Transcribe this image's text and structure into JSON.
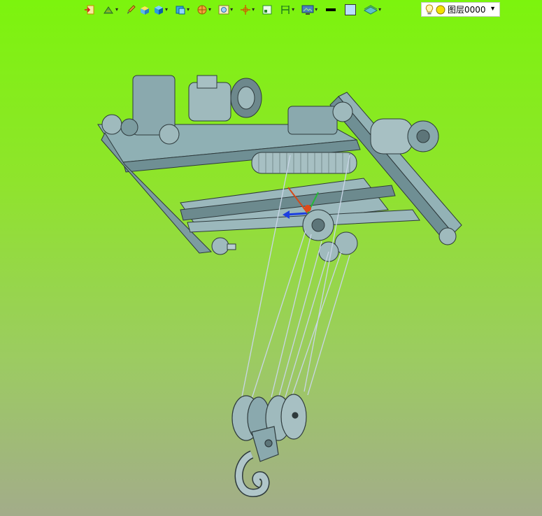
{
  "toolbar": {
    "items": [
      {
        "icon": "exit-view-icon",
        "dropdown": false
      },
      {
        "icon": "render-style-icon",
        "dropdown": true
      },
      {
        "icon": "brush-icon",
        "dropdown": false
      },
      {
        "icon": "box-shaded-icon",
        "dropdown": false
      },
      {
        "icon": "cube-view-icon",
        "dropdown": true
      },
      {
        "icon": "section-view-icon",
        "dropdown": true
      },
      {
        "icon": "sphere-view-icon",
        "dropdown": true
      },
      {
        "icon": "zoom-fit-icon",
        "dropdown": true
      },
      {
        "icon": "orient-axis-icon",
        "dropdown": true
      },
      {
        "icon": "work-plane-icon",
        "dropdown": false
      },
      {
        "icon": "dimension-icon",
        "dropdown": true
      },
      {
        "icon": "monitor-display-icon",
        "dropdown": true
      },
      {
        "icon": "line-color-icon",
        "dropdown": false
      },
      {
        "icon": "fill-color-icon",
        "dropdown": false
      },
      {
        "icon": "layer-plane-icon",
        "dropdown": true
      }
    ]
  },
  "layer": {
    "name": "图层0000"
  },
  "colors": {
    "bg_top": "#7cf40d",
    "bg_bottom": "#a3ac8a",
    "model": "#8aa9ae",
    "model_dark": "#3c4a4c"
  }
}
